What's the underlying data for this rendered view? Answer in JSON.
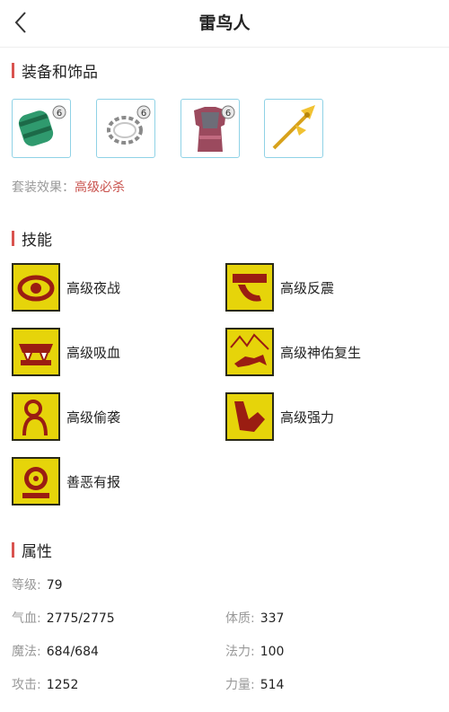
{
  "header": {
    "title": "雷鸟人",
    "back_icon": "chevron-left-icon"
  },
  "equipment": {
    "section_title": "装备和饰品",
    "items": [
      {
        "icon": "green-bracer-icon",
        "level_badge": "6"
      },
      {
        "icon": "chain-necklace-icon",
        "level_badge": "6"
      },
      {
        "icon": "armor-icon",
        "level_badge": "6"
      },
      {
        "icon": "golden-hairpin-icon",
        "level_badge": ""
      }
    ],
    "set_effect_label": "套装效果：",
    "set_effect_value": "高级必杀"
  },
  "skills": {
    "section_title": "技能",
    "items": [
      {
        "name": "高级夜战",
        "icon": "eye-icon"
      },
      {
        "name": "高级反震",
        "icon": "arm-shield-icon"
      },
      {
        "name": "高级吸血",
        "icon": "fangs-icon"
      },
      {
        "name": "高级神佑复生",
        "icon": "mountain-horse-icon"
      },
      {
        "name": "高级偷袭",
        "icon": "sneak-figure-icon"
      },
      {
        "name": "高级强力",
        "icon": "flexed-arm-icon"
      },
      {
        "name": "善恶有报",
        "icon": "karma-seal-icon"
      }
    ]
  },
  "attributes": {
    "section_title": "属性",
    "level_label": "等级:",
    "level_value": "79",
    "rows": [
      {
        "left_label": "气血:",
        "left_value": "2775/2775",
        "right_label": "体质:",
        "right_value": "337"
      },
      {
        "left_label": "魔法:",
        "left_value": "684/684",
        "right_label": "法力:",
        "right_value": "100"
      },
      {
        "left_label": "攻击:",
        "left_value": "1252",
        "right_label": "力量:",
        "right_value": "514"
      }
    ]
  },
  "colors": {
    "accent": "#d9534f",
    "set_effect": "#c9534e",
    "skill_icon_bg": "#e6d40a",
    "equip_border": "#8fd2e6"
  }
}
